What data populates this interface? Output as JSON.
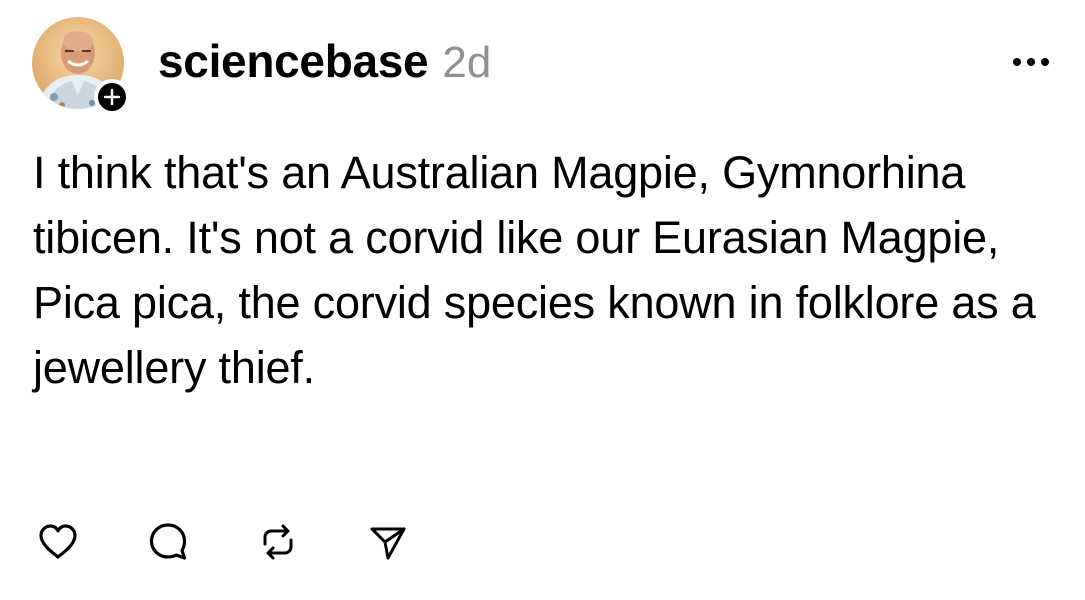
{
  "post": {
    "username": "sciencebase",
    "timestamp": "2d",
    "text": "I think that's an Australian Magpie, Gymnorhina tibicen. It's not a corvid like our Eurasian Magpie, Pica pica, the corvid species known in folklore as a jewellery thief."
  },
  "icons": {
    "avatar": "profile-photo",
    "follow": "plus-icon",
    "more": "more-horizontal-icon",
    "like": "heart-icon",
    "comment": "comment-bubble-icon",
    "repost": "repost-icon",
    "share": "send-icon"
  },
  "colors": {
    "text": "#000000",
    "muted": "#8e8e93",
    "background": "#ffffff"
  }
}
